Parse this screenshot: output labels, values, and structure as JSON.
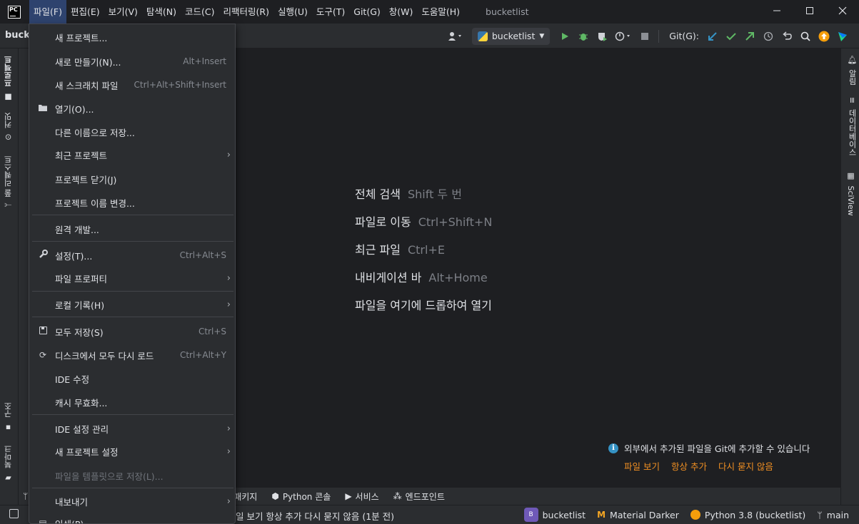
{
  "titlebar": {
    "app_icon_text": "PC",
    "menus": [
      "파일(F)",
      "편집(E)",
      "보기(V)",
      "탐색(N)",
      "코드(C)",
      "리팩터링(R)",
      "실행(U)",
      "도구(T)",
      "Git(G)",
      "창(W)",
      "도움말(H)"
    ],
    "window_title": "bucketlist",
    "controls": [
      "minimize-icon",
      "maximize-icon",
      "close-icon"
    ]
  },
  "toolbar": {
    "project_label": "bucke",
    "run_config": "bucketlist",
    "git_label": "Git(G):",
    "icons": [
      "user-icon",
      "run-icon",
      "debug-icon",
      "coverage-icon",
      "profile-icon",
      "stop-icon",
      "update-icon",
      "commit-icon",
      "push-icon",
      "history-icon",
      "rollback-icon",
      "search-icon",
      "update-available-icon",
      "jetbrains-icon"
    ]
  },
  "left_strip": {
    "tabs": [
      "프로젝트",
      "커밋",
      "풀 리퀘스트",
      "구조",
      "북마크"
    ]
  },
  "right_strip": {
    "tabs": [
      "알림",
      "데이터베이스",
      "SciView"
    ]
  },
  "editor_hints": [
    {
      "label": "전체 검색",
      "shortcut": "Shift 두 번"
    },
    {
      "label": "파일로 이동",
      "shortcut": "Ctrl+Shift+N"
    },
    {
      "label": "최근 파일",
      "shortcut": "Ctrl+E"
    },
    {
      "label": "내비게이션 바",
      "shortcut": "Alt+Home"
    },
    {
      "label": "파일을 여기에 드롭하여 열기",
      "shortcut": ""
    }
  ],
  "notification": {
    "message": "외부에서 추가된 파일을 Git에 추가할 수 있습니다",
    "actions": [
      "파일 보기",
      "항상 추가",
      "다시 묻지 않음"
    ]
  },
  "bottom_tabs": [
    "패키지",
    "Python 콘솔",
    "서비스",
    "엔드포인트"
  ],
  "statusbar": {
    "message": "일 보기  항상 추가  다시 묻지 않음 (1분 전)",
    "project_badge": "B",
    "project": "bucketlist",
    "theme": "Material Darker",
    "interpreter": "Python 3.8 (bucketlist)",
    "branch": "main"
  },
  "file_menu": {
    "items": [
      {
        "label": "새 프로젝트...",
        "shortcut": "",
        "submenu": false,
        "icon": ""
      },
      {
        "label": "새로 만들기(N)...",
        "shortcut": "Alt+Insert",
        "submenu": false,
        "icon": ""
      },
      {
        "label": "새 스크래치 파일",
        "shortcut": "Ctrl+Alt+Shift+Insert",
        "submenu": false,
        "icon": ""
      },
      {
        "label": "열기(O)...",
        "shortcut": "",
        "submenu": false,
        "icon": "folder-icon"
      },
      {
        "label": "다른 이름으로 저장...",
        "shortcut": "",
        "submenu": false,
        "icon": ""
      },
      {
        "label": "최근 프로젝트",
        "shortcut": "",
        "submenu": true,
        "icon": ""
      },
      {
        "label": "프로젝트 닫기(J)",
        "shortcut": "",
        "submenu": false,
        "icon": ""
      },
      {
        "label": "프로젝트 이름 변경...",
        "shortcut": "",
        "submenu": false,
        "icon": ""
      },
      {
        "label": "원격 개발...",
        "shortcut": "",
        "submenu": false,
        "icon": ""
      },
      {
        "label": "설정(T)...",
        "shortcut": "Ctrl+Alt+S",
        "submenu": false,
        "icon": "wrench-icon"
      },
      {
        "label": "파일 프로퍼티",
        "shortcut": "",
        "submenu": true,
        "icon": ""
      },
      {
        "label": "로컬 기록(H)",
        "shortcut": "",
        "submenu": true,
        "icon": ""
      },
      {
        "label": "모두 저장(S)",
        "shortcut": "Ctrl+S",
        "submenu": false,
        "icon": "save-icon"
      },
      {
        "label": "디스크에서 모두 다시 로드",
        "shortcut": "Ctrl+Alt+Y",
        "submenu": false,
        "icon": "reload-icon"
      },
      {
        "label": "IDE 수정",
        "shortcut": "",
        "submenu": false,
        "icon": ""
      },
      {
        "label": "캐시 무효화...",
        "shortcut": "",
        "submenu": false,
        "icon": ""
      },
      {
        "label": "IDE 설정 관리",
        "shortcut": "",
        "submenu": true,
        "icon": ""
      },
      {
        "label": "새 프로젝트 설정",
        "shortcut": "",
        "submenu": true,
        "icon": ""
      },
      {
        "label": "파일을 템플릿으로 저장(L)...",
        "shortcut": "",
        "submenu": false,
        "icon": "",
        "disabled": true
      },
      {
        "label": "내보내기",
        "shortcut": "",
        "submenu": true,
        "icon": ""
      },
      {
        "label": "인쇄(P)...",
        "shortcut": "",
        "submenu": false,
        "icon": "print-icon"
      }
    ]
  }
}
